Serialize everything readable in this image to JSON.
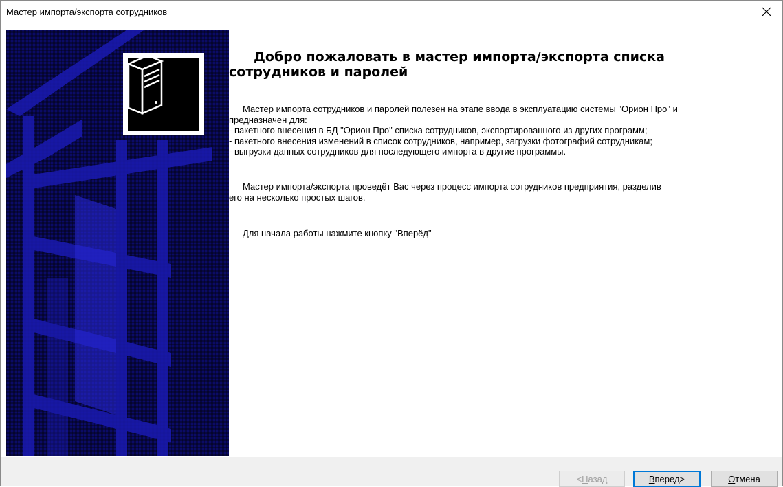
{
  "window": {
    "title": "Мастер импорта/экспорта сотрудников",
    "close_glyph": "✕"
  },
  "main": {
    "heading_line1": "Добро пожаловать в мастер импорта/экспорта списка",
    "heading_line2": "сотрудников и паролей",
    "para1": [
      "Мастер импорта сотрудников и паролей полезен на этапе ввода в эксплуатацию системы \"Орион Про\" и",
      "предназначен для:",
      "- пакетного внесения в БД \"Орион Про\" списка сотрудников, экспортированного из других программ;",
      "- пакетного внесения изменений в список сотрудников, например, загрузки фотографий сотрудникам;",
      "- выгрузки данных сотрудников для последующего импорта в другие программы."
    ],
    "para2": [
      "Мастер импорта/экспорта проведёт Вас через процесс импорта сотрудников предприятия, разделив",
      "его на несколько простых шагов."
    ],
    "para3": "Для начала работы нажмите кнопку \"Вперёд\""
  },
  "buttons": {
    "back": {
      "prefix": "< ",
      "accel": "Н",
      "rest": "азад"
    },
    "next": {
      "accel": "В",
      "rest": "перед",
      "suffix": " >"
    },
    "cancel": {
      "accel": "О",
      "rest": "тмена"
    }
  },
  "icons": {
    "wizard_icon": "computer-tower-icon",
    "close": "close-icon"
  },
  "colors": {
    "side_panel": "#0b0b66",
    "side_stripes": "#1a1ab0",
    "default_button_border": "#0078d7"
  }
}
